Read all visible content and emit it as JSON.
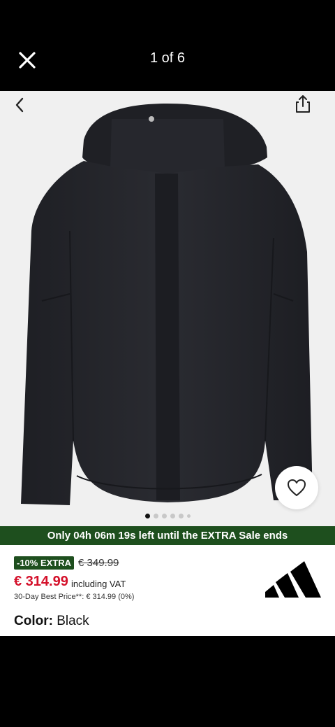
{
  "viewer": {
    "counter": "1 of 6"
  },
  "promo": {
    "text": "Only 04h 06m 19s left until the EXTRA Sale ends"
  },
  "pricing": {
    "badge": "-10% EXTRA",
    "original_price": "€ 349.99",
    "price": "€ 314.99",
    "vat_note": "including VAT",
    "best_price_note": "30-Day Best Price**: € 314.99 (0%)"
  },
  "color": {
    "label": "Color:",
    "value": "Black"
  },
  "gallery": {
    "total_dots": 6,
    "active_index": 0
  },
  "colors": {
    "promo_bg": "#1e4f1e",
    "price_red": "#d4102a",
    "status_pill": "#f3c500"
  },
  "icons": [
    "close-icon",
    "back-chevron-icon",
    "share-icon",
    "heart-icon",
    "adidas-logo"
  ]
}
